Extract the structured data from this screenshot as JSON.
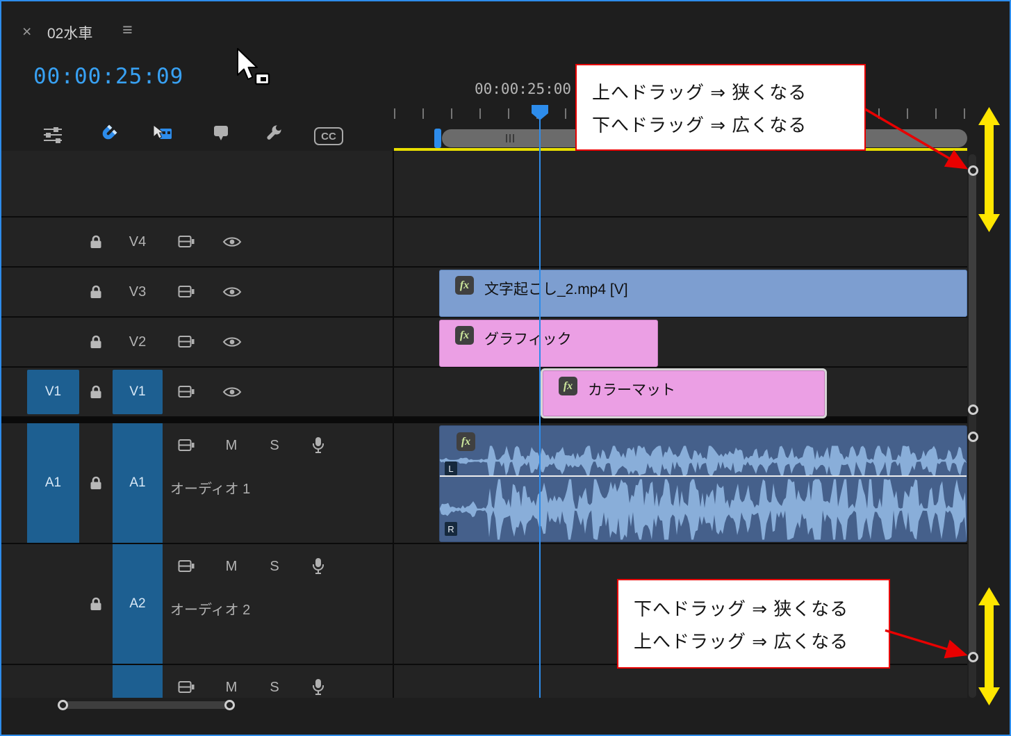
{
  "tab": {
    "close_icon": "×",
    "title": "02水車",
    "menu_icon": "≡"
  },
  "timecode": {
    "current": "00:00:25:09"
  },
  "ruler": {
    "playhead_label": "00:00:25:00"
  },
  "toolbar": {
    "cc_label": "CC"
  },
  "video_tracks": [
    {
      "name": "V4"
    },
    {
      "name": "V3"
    },
    {
      "name": "V2"
    },
    {
      "name": "V1",
      "source": "V1"
    }
  ],
  "audio_tracks": [
    {
      "name": "A1",
      "source": "A1",
      "label": "オーディオ 1",
      "mute": "M",
      "solo": "S"
    },
    {
      "name": "A2",
      "label": "オーディオ 2",
      "mute": "M",
      "solo": "S"
    },
    {
      "name": "",
      "label": "",
      "mute": "M",
      "solo": "S"
    }
  ],
  "clips": {
    "v3": {
      "fx_badge": "fx",
      "name": "文字起こし_2.mp4 [V]"
    },
    "v2": {
      "fx_badge": "fx",
      "name": "グラフィック"
    },
    "v1": {
      "fx_badge": "fx",
      "name": "カラーマット"
    },
    "a1": {
      "fx_badge": "fx",
      "left_channel": "L",
      "right_channel": "R"
    }
  },
  "annotations": {
    "top_box": {
      "line1": "上へドラッグ ⇒ 狭くなる",
      "line2": "下へドラッグ ⇒ 広くなる"
    },
    "bottom_box": {
      "line1": "下へドラッグ ⇒ 狭くなる",
      "line2": "上へドラッグ ⇒ 広くなる"
    }
  },
  "colors": {
    "panel_accent": "#2d8ceb",
    "timecode_blue": "#38a1f3",
    "clip_blue": "#7d9ed0",
    "clip_pink": "#eb9fe4",
    "audio_clip_blue": "#45608b",
    "waveform_blue": "#8fb5e0",
    "target_blue": "#1d5f91",
    "work_area_yellow": "#e8de00",
    "annotation_red": "#e80000",
    "arrow_yellow": "#ffe600",
    "selection_white": "#d6d6d6"
  }
}
